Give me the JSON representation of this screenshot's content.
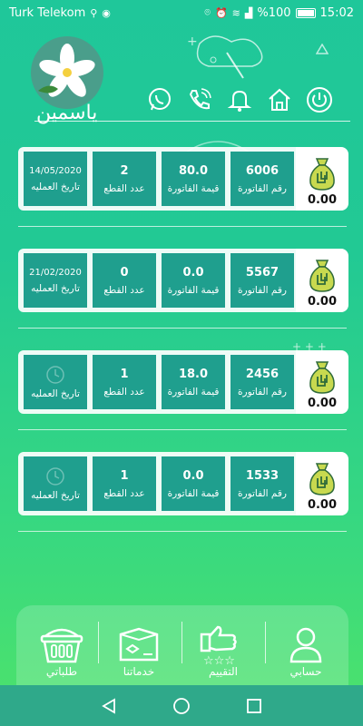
{
  "status_bar": {
    "carrier": "Turk Telekom",
    "battery": "%100",
    "time": "15:02"
  },
  "header": {
    "logo_text": "ياسمين",
    "icons": [
      "power-icon",
      "home-icon",
      "bell-icon",
      "phone-icon",
      "whatsapp-icon"
    ]
  },
  "labels": {
    "invoice_number": "رقم الفاتورة",
    "invoice_value": "قيمة الفاتورة",
    "item_count": "عدد القطع",
    "operation_date": "تاريخ العمليه"
  },
  "orders": [
    {
      "invoice_number": "6006",
      "invoice_value": "80.0",
      "item_count": "2",
      "date": "14/05/2020",
      "amount": "0.00"
    },
    {
      "invoice_number": "5567",
      "invoice_value": "0.0",
      "item_count": "0",
      "date": "21/02/2020",
      "amount": "0.00"
    },
    {
      "invoice_number": "2456",
      "invoice_value": "18.0",
      "item_count": "1",
      "date": "",
      "amount": "0.00"
    },
    {
      "invoice_number": "1533",
      "invoice_value": "0.0",
      "item_count": "1",
      "date": "",
      "amount": "0.00"
    }
  ],
  "bottom_nav": {
    "account": "حسابي",
    "rating": "التقييم",
    "services": "خدماتنا",
    "orders": "طلباتي"
  },
  "colors": {
    "accent": "#1f9f8e",
    "bag": "#c8d94f",
    "bag_stroke": "#2f6b3a"
  }
}
